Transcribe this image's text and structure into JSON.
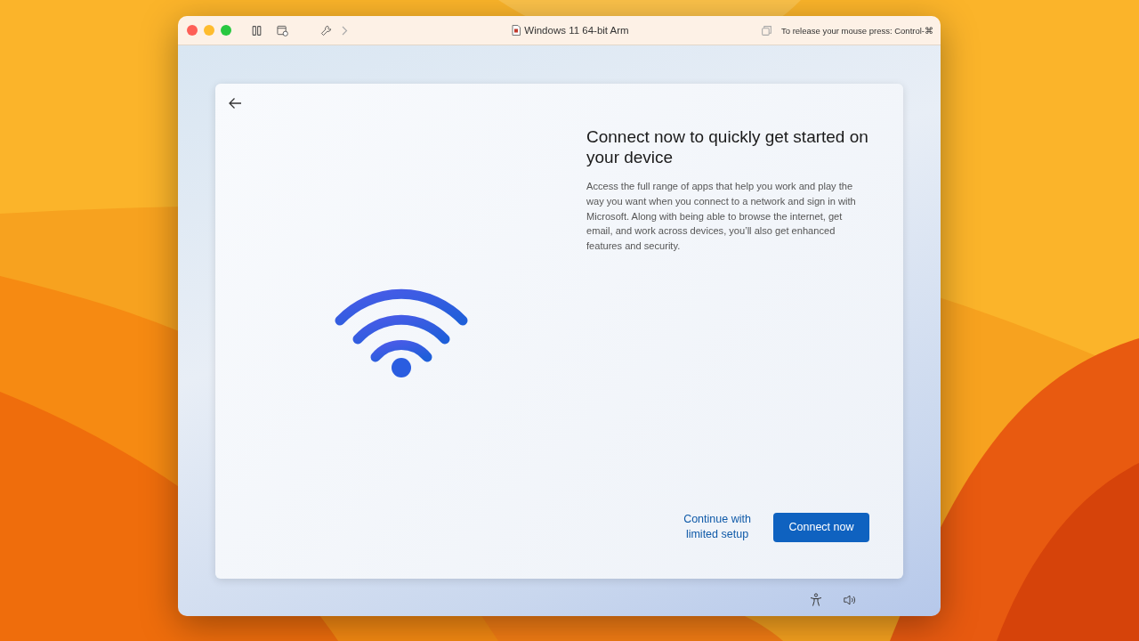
{
  "window": {
    "title": "Windows 11 64-bit Arm",
    "release_hint": "To release your mouse press: Control-⌘"
  },
  "setup": {
    "title": "Connect now to quickly get started on your device",
    "body": "Access the full range of apps that help you work and play the way you want when you connect to a network and sign in with Microsoft. Along with being able to browse the internet, get email, and work across devices, you’ll also get enhanced features and security.",
    "buttons": [
      {
        "kind": "link",
        "label": "Continue with limited setup"
      },
      {
        "kind": "primary",
        "label": "Connect now"
      }
    ]
  }
}
